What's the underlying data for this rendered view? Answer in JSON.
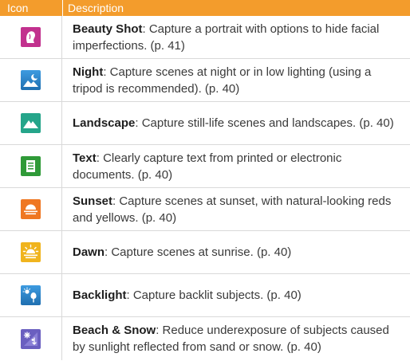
{
  "header": {
    "icon_col": "Icon",
    "desc_col": "Description"
  },
  "colors": {
    "header_bg": "#f39c2c",
    "beauty": "#c2318e",
    "night": "#2b88cc",
    "landscape": "#25a58a",
    "text": "#2f9a38",
    "sunset": "#ef7722",
    "dawn": "#f0b41e",
    "backlight": "#2b88cc",
    "beach": "#6a5fc0"
  },
  "rows": [
    {
      "icon": "beauty-shot-icon",
      "name": "Beauty Shot",
      "desc": ": Capture a portrait with options to hide facial imperfections. (p. 41)"
    },
    {
      "icon": "night-icon",
      "name": "Night",
      "desc": ": Capture scenes at night or in low lighting (using a tripod is recommended). (p. 40)"
    },
    {
      "icon": "landscape-icon",
      "name": "Landscape",
      "desc": ": Capture still-life scenes and landscapes. (p. 40)"
    },
    {
      "icon": "text-icon",
      "name": "Text",
      "desc": ": Clearly capture text from printed or electronic documents. (p. 40)"
    },
    {
      "icon": "sunset-icon",
      "name": "Sunset",
      "desc": ": Capture scenes at sunset, with natural-looking reds and yellows. (p. 40)"
    },
    {
      "icon": "dawn-icon",
      "name": "Dawn",
      "desc": ": Capture scenes at sunrise. (p. 40)"
    },
    {
      "icon": "backlight-icon",
      "name": "Backlight",
      "desc": ": Capture backlit subjects. (p. 40)"
    },
    {
      "icon": "beach-snow-icon",
      "name": "Beach & Snow",
      "desc": ": Reduce underexposure of subjects caused by sunlight reflected from sand or snow. (p. 40)"
    }
  ]
}
